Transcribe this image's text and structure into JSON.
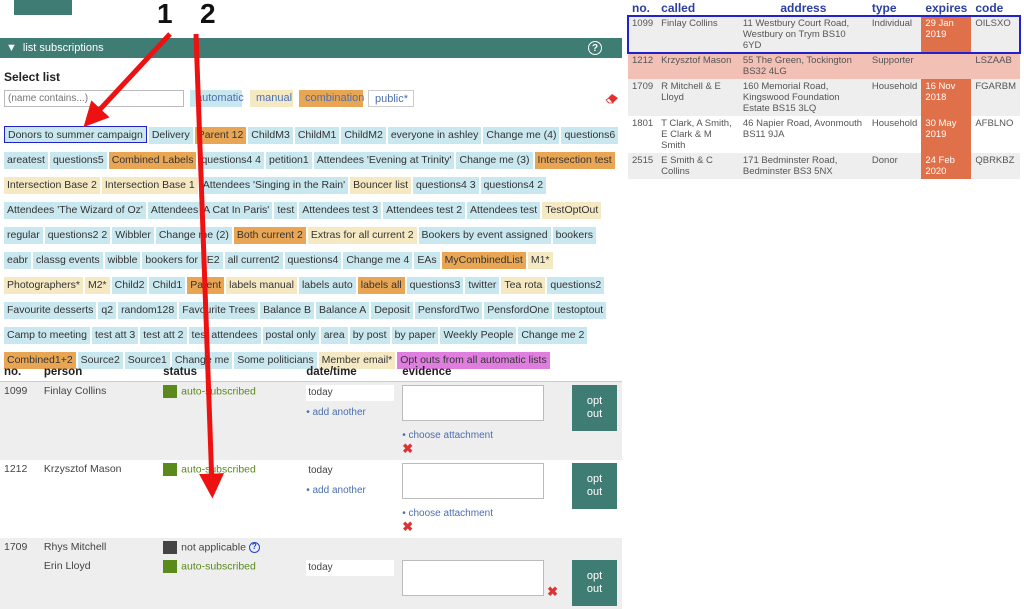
{
  "section": {
    "title": "list subscriptions",
    "toggle_glyph": "▼",
    "help_glyph": "?"
  },
  "select_list": {
    "heading": "Select list",
    "search_placeholder": "(name contains...)",
    "filters": [
      "automatic",
      "manual",
      "combination",
      "public*"
    ]
  },
  "tags": [
    {
      "label": "Donors to summer campaign",
      "kind": "sel"
    },
    {
      "label": "Delivery",
      "kind": "a"
    },
    {
      "label": "Parent 12",
      "kind": "c"
    },
    {
      "label": "ChildM3",
      "kind": "a"
    },
    {
      "label": "ChildM1",
      "kind": "a"
    },
    {
      "label": "ChildM2",
      "kind": "a"
    },
    {
      "label": "everyone in ashley",
      "kind": "a"
    },
    {
      "label": "Change me (4)",
      "kind": "a"
    },
    {
      "label": "questions6",
      "kind": "a"
    },
    {
      "label": "areatest",
      "kind": "a"
    },
    {
      "label": "questions5",
      "kind": "a"
    },
    {
      "label": "Combined Labels",
      "kind": "c"
    },
    {
      "label": "questions4 4",
      "kind": "a"
    },
    {
      "label": "petition1",
      "kind": "a"
    },
    {
      "label": "Attendees 'Evening at Trinity'",
      "kind": "a"
    },
    {
      "label": "Change me (3)",
      "kind": "a"
    },
    {
      "label": "Intersection test",
      "kind": "c"
    },
    {
      "label": "Intersection Base 2",
      "kind": "m"
    },
    {
      "label": "Intersection Base 1",
      "kind": "m"
    },
    {
      "label": "Attendees 'Singing in the Rain'",
      "kind": "a"
    },
    {
      "label": "Bouncer list",
      "kind": "m"
    },
    {
      "label": "questions4 3",
      "kind": "a"
    },
    {
      "label": "questions4 2",
      "kind": "a"
    },
    {
      "label": "Attendees 'The Wizard of Oz'",
      "kind": "a"
    },
    {
      "label": "Attendees 'A Cat In Paris'",
      "kind": "a"
    },
    {
      "label": "test",
      "kind": "a"
    },
    {
      "label": "Attendees test 3",
      "kind": "a"
    },
    {
      "label": "Attendees test 2",
      "kind": "a"
    },
    {
      "label": "Attendees test",
      "kind": "a"
    },
    {
      "label": "TestOptOut",
      "kind": "m"
    },
    {
      "label": "regular",
      "kind": "a"
    },
    {
      "label": "questions2 2",
      "kind": "a"
    },
    {
      "label": "Wibbler",
      "kind": "a"
    },
    {
      "label": "Change me (2)",
      "kind": "a"
    },
    {
      "label": "Both current 2",
      "kind": "c"
    },
    {
      "label": "Extras for all current 2",
      "kind": "m"
    },
    {
      "label": "Bookers by event assigned",
      "kind": "a"
    },
    {
      "label": "bookers",
      "kind": "a"
    },
    {
      "label": "eabr",
      "kind": "a"
    },
    {
      "label": "classg events",
      "kind": "a"
    },
    {
      "label": "wibble",
      "kind": "a"
    },
    {
      "label": "bookers for LE2",
      "kind": "a"
    },
    {
      "label": "all current2",
      "kind": "a"
    },
    {
      "label": "questions4",
      "kind": "a"
    },
    {
      "label": "Change me 4",
      "kind": "a"
    },
    {
      "label": "EAs",
      "kind": "a"
    },
    {
      "label": "MyCombinedList",
      "kind": "c"
    },
    {
      "label": "M1*",
      "kind": "m"
    },
    {
      "label": "Photographers*",
      "kind": "m"
    },
    {
      "label": "M2*",
      "kind": "m"
    },
    {
      "label": "Child2",
      "kind": "a"
    },
    {
      "label": "Child1",
      "kind": "a"
    },
    {
      "label": "Parent",
      "kind": "c"
    },
    {
      "label": "labels manual",
      "kind": "m"
    },
    {
      "label": "labels auto",
      "kind": "a"
    },
    {
      "label": "labels all",
      "kind": "c"
    },
    {
      "label": "questions3",
      "kind": "a"
    },
    {
      "label": "twitter",
      "kind": "a"
    },
    {
      "label": "Tea rota",
      "kind": "m"
    },
    {
      "label": "questions2",
      "kind": "a"
    },
    {
      "label": "Favourite desserts",
      "kind": "a"
    },
    {
      "label": "q2",
      "kind": "a"
    },
    {
      "label": "random128",
      "kind": "a"
    },
    {
      "label": "Favourite Trees",
      "kind": "a"
    },
    {
      "label": "Balance B",
      "kind": "a"
    },
    {
      "label": "Balance A",
      "kind": "a"
    },
    {
      "label": "Deposit",
      "kind": "a"
    },
    {
      "label": "PensfordTwo",
      "kind": "a"
    },
    {
      "label": "PensfordOne",
      "kind": "a"
    },
    {
      "label": "testoptout",
      "kind": "a"
    },
    {
      "label": "Camp to meeting",
      "kind": "a"
    },
    {
      "label": "test att 3",
      "kind": "a"
    },
    {
      "label": "test att 2",
      "kind": "a"
    },
    {
      "label": "test attendees",
      "kind": "a"
    },
    {
      "label": "postal only",
      "kind": "a"
    },
    {
      "label": "area",
      "kind": "a"
    },
    {
      "label": "by post",
      "kind": "a"
    },
    {
      "label": "by paper",
      "kind": "a"
    },
    {
      "label": "Weekly People",
      "kind": "a"
    },
    {
      "label": "Change me 2",
      "kind": "a"
    },
    {
      "label": "Combined1+2",
      "kind": "c"
    },
    {
      "label": "Source2",
      "kind": "a"
    },
    {
      "label": "Source1",
      "kind": "a"
    },
    {
      "label": "Change me",
      "kind": "a"
    },
    {
      "label": "Some politicians",
      "kind": "a"
    },
    {
      "label": "Member email*",
      "kind": "m"
    },
    {
      "label": "Opt outs from all automatic lists",
      "kind": "opt"
    }
  ],
  "subs_table": {
    "headers": [
      "no.",
      "person",
      "status",
      "date/time",
      "evidence"
    ],
    "add_another": "• add another",
    "choose_attachment": "• choose attachment",
    "opt_out": "opt out",
    "rows": [
      {
        "no": "1099",
        "person": "Finlay Collins",
        "status": "auto-subscribed",
        "status_color": "#5a8a1a",
        "date": "today",
        "grey": true
      },
      {
        "no": "1212",
        "person": "Krzysztof Mason",
        "status": "auto-subscribed",
        "status_color": "#5a8a1a",
        "date": "today",
        "grey": false
      },
      {
        "no": "1709",
        "person": "Rhys Mitchell",
        "status": "not applicable",
        "status_color": "#444444",
        "date": "",
        "grey": true,
        "na": true
      },
      {
        "no": "",
        "person": "Erin Lloyd",
        "status": "auto-subscribed",
        "status_color": "#5a8a1a",
        "date": "today",
        "grey": true
      }
    ]
  },
  "people_table": {
    "headers": [
      "no.",
      "called",
      "address",
      "type",
      "expires",
      "code"
    ],
    "rows": [
      {
        "no": "1099",
        "called": "Finlay Collins",
        "address": "11 Westbury Court Road, Westbury on Trym BS10 6YD",
        "type": "Individual",
        "expires": "29 Jan 2019",
        "code": "OILSXO",
        "style": "sel"
      },
      {
        "no": "1212",
        "called": "Krzysztof Mason",
        "address": "55 The Green, Tockington BS32 4LG",
        "type": "Supporter",
        "expires": "",
        "code": "LSZAAB",
        "style": "pink"
      },
      {
        "no": "1709",
        "called": "R Mitchell & E Lloyd",
        "address": "160 Memorial Road, Kingswood Foundation Estate BS15 3LQ",
        "type": "Household",
        "expires": "16 Nov 2018",
        "code": "FGARBM",
        "style": "alt"
      },
      {
        "no": "1801",
        "called": "T Clark, A Smith, E Clark & M Smith",
        "address": "46 Napier Road, Avonmouth BS11 9JA",
        "type": "Household",
        "expires": "30 May 2019",
        "code": "AFBLNO",
        "style": "plain"
      },
      {
        "no": "2515",
        "called": "E Smith & C Collins",
        "address": "171 Bedminster Road, Bedminster BS3 5NX",
        "type": "Donor",
        "expires": "24 Feb 2020",
        "code": "QBRKBZ",
        "style": "alt"
      }
    ]
  },
  "annotations": [
    "1",
    "2"
  ]
}
